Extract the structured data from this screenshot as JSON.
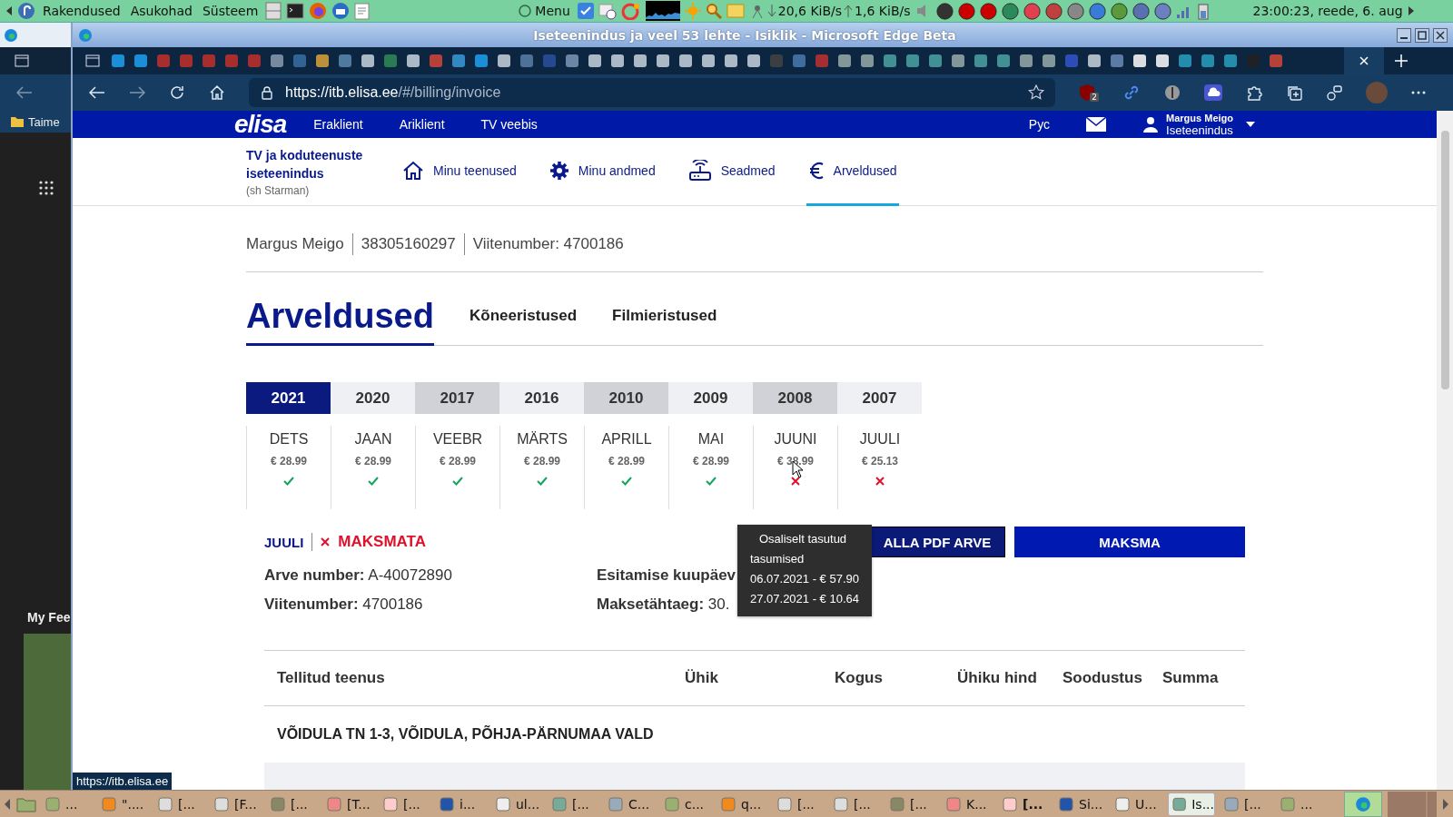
{
  "desktop_panel": {
    "menus": [
      "Rakendused",
      "Asukohad",
      "Süsteem"
    ],
    "menu_button": "Menu",
    "download_speed": "20,6 KiB/s",
    "upload_speed": "1,6 KiB/s",
    "clock": "23:00:23, reede,  6. aug"
  },
  "background_window": {
    "bookmark": "Taime",
    "feed_title": "My Fee"
  },
  "window": {
    "title": "Iseteenindus ja veel 53 lehte - Isiklik - Microsoft Edge Beta"
  },
  "browser": {
    "url_host": "https://itb.elisa.ee",
    "url_path": "/#/billing/invoice",
    "extension_badge": "2",
    "status_link": "https://itb.elisa.ee"
  },
  "site_header": {
    "logo": "elisa",
    "nav": [
      "Eraklient",
      "Ariklient",
      "TV veebis"
    ],
    "language": "Рус",
    "user_name": "Margus Meigo",
    "user_role": "Iseteenindus"
  },
  "subnav": {
    "title": "TV ja koduteenuste iseteenindus",
    "subtitle": "(sh Starman)",
    "items": [
      {
        "label": "Minu teenused",
        "kind": "home",
        "selected": false
      },
      {
        "label": "Minu andmed",
        "kind": "gear",
        "selected": false
      },
      {
        "label": "Seadmed",
        "kind": "router",
        "selected": false
      },
      {
        "label": "Arveldused",
        "kind": "euro",
        "selected": true
      }
    ]
  },
  "customer": [
    "Margus Meigo",
    "38305160297",
    "Viitenumber: 4700186"
  ],
  "page_tabs": [
    {
      "label": "Arveldused",
      "selected": true
    },
    {
      "label": "Kõneeristused",
      "selected": false
    },
    {
      "label": "Filmieristused",
      "selected": false
    }
  ],
  "years": [
    {
      "label": "2021",
      "selected": true,
      "shaded": false
    },
    {
      "label": "2020",
      "selected": false,
      "shaded": false
    },
    {
      "label": "2017",
      "selected": false,
      "shaded": true
    },
    {
      "label": "2016",
      "selected": false,
      "shaded": false
    },
    {
      "label": "2010",
      "selected": false,
      "shaded": true
    },
    {
      "label": "2009",
      "selected": false,
      "shaded": false
    },
    {
      "label": "2008",
      "selected": false,
      "shaded": true
    },
    {
      "label": "2007",
      "selected": false,
      "shaded": false
    }
  ],
  "months": [
    {
      "name": "DETS",
      "amount": "€ 28.99",
      "paid": true
    },
    {
      "name": "JAAN",
      "amount": "€ 28.99",
      "paid": true
    },
    {
      "name": "VEEBR",
      "amount": "€ 28.99",
      "paid": true
    },
    {
      "name": "MÄRTS",
      "amount": "€ 28.99",
      "paid": true
    },
    {
      "name": "APRILL",
      "amount": "€ 28.99",
      "paid": true
    },
    {
      "name": "MAI",
      "amount": "€ 28.99",
      "paid": true
    },
    {
      "name": "JUUNI",
      "amount": "€ 38.99",
      "paid": false
    },
    {
      "name": "JUULI",
      "amount": "€ 25.13",
      "paid": false
    }
  ],
  "invoice_status": {
    "month": "JUULI",
    "status": "MAKSMATA",
    "paid": false
  },
  "buttons": [
    {
      "label": "ALLA PDF ARVE",
      "kind": "secondary"
    },
    {
      "label": "MAKSMA",
      "kind": "primary"
    }
  ],
  "invoice_fields": [
    {
      "label": "Arve number:",
      "value": "A-40072890"
    },
    {
      "label": "Esitamise kuupäev"
    },
    {
      "label": "Viitenumber:",
      "value": "4700186"
    },
    {
      "label": "Maksetähtaeg:",
      "value": "30."
    }
  ],
  "table": {
    "columns": [
      "Tellitud teenus",
      "Ühik",
      "Kogus",
      "Ühiku hind",
      "Soodustus",
      "Summa"
    ],
    "group": "VÕIDULA TN 1-3, VÕIDULA, PÕHJA-PÄRNUMAA VALD"
  },
  "tooltip": {
    "title": "Osaliselt tasutud",
    "subtitle": "tasumised",
    "lines": [
      "06.07.2021 - € 57.90",
      "27.07.2021 - € 10.64"
    ]
  },
  "taskbar": [
    {
      "label": "...",
      "selected": false,
      "attention": false
    },
    {
      "label": "\"....",
      "selected": false,
      "attention": false
    },
    {
      "label": "[...",
      "selected": false,
      "attention": false
    },
    {
      "label": "[F...",
      "selected": false,
      "attention": false
    },
    {
      "label": "[...",
      "selected": false,
      "attention": false
    },
    {
      "label": "[T...",
      "selected": false,
      "attention": false
    },
    {
      "label": "[...",
      "selected": false,
      "attention": false
    },
    {
      "label": "i...",
      "selected": false,
      "attention": false
    },
    {
      "label": "ul...",
      "selected": false,
      "attention": false
    },
    {
      "label": "[...",
      "selected": false,
      "attention": false
    },
    {
      "label": "C...",
      "selected": false,
      "attention": false
    },
    {
      "label": "c...",
      "selected": false,
      "attention": false
    },
    {
      "label": "q...",
      "selected": false,
      "attention": false
    },
    {
      "label": "[...",
      "selected": false,
      "attention": false
    },
    {
      "label": "[...",
      "selected": false,
      "attention": false
    },
    {
      "label": "[...",
      "selected": false,
      "attention": false
    },
    {
      "label": "K...",
      "selected": false,
      "attention": false
    },
    {
      "label": "[...",
      "selected": false,
      "attention": true
    },
    {
      "label": "Si...",
      "selected": false,
      "attention": false
    },
    {
      "label": "U...",
      "selected": false,
      "attention": false
    },
    {
      "label": "Is...",
      "selected": true,
      "attention": false
    },
    {
      "label": "[...",
      "selected": false,
      "attention": false
    },
    {
      "label": "...",
      "selected": false,
      "attention": false
    }
  ]
}
